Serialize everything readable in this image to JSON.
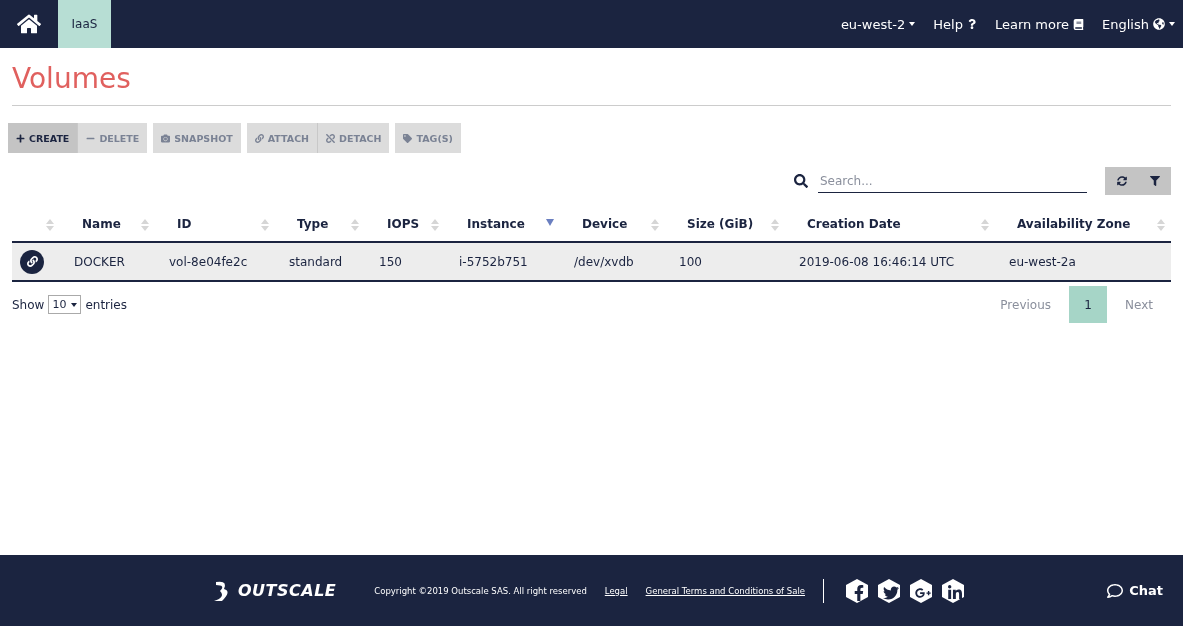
{
  "nav": {
    "section": "IaaS",
    "section_selected": true,
    "right": [
      {
        "label": "eu-west-2",
        "kind": "dropdown"
      },
      {
        "label": "Help",
        "kind": "help"
      },
      {
        "label": "Learn more",
        "kind": "book"
      },
      {
        "label": "English",
        "kind": "language"
      }
    ]
  },
  "title": "Volumes",
  "toolbar": [
    [
      {
        "label": "CREATE",
        "kind": "plus",
        "disabled": false
      },
      {
        "label": "DELETE",
        "kind": "minus",
        "disabled": true
      }
    ],
    [
      {
        "label": "SNAPSHOT",
        "kind": "camera",
        "disabled": true
      }
    ],
    [
      {
        "label": "ATTACH",
        "kind": "link",
        "disabled": true
      },
      {
        "label": "DETACH",
        "kind": "unlink",
        "disabled": true
      }
    ],
    [
      {
        "label": "TAG(S)",
        "kind": "tag",
        "disabled": true
      }
    ]
  ],
  "search": {
    "placeholder": "Search..."
  },
  "table": {
    "columns": [
      {
        "label": "Name",
        "sorted": false
      },
      {
        "label": "ID",
        "sorted": false
      },
      {
        "label": "Type",
        "sorted": false
      },
      {
        "label": "IOPS",
        "sorted": false
      },
      {
        "label": "Instance",
        "sorted": true
      },
      {
        "label": "Device",
        "sorted": false
      },
      {
        "label": "Size (GiB)",
        "sorted": false
      },
      {
        "label": "Creation Date",
        "sorted": false
      },
      {
        "label": "Availability Zone",
        "sorted": false
      }
    ],
    "rows": [
      {
        "attached": true,
        "cells": [
          "DOCKER",
          "vol-8e04fe2c",
          "standard",
          "150",
          "i-5752b751",
          "/dev/xvdb",
          "100",
          "2019-06-08 16:46:14 UTC",
          "eu-west-2a"
        ]
      }
    ]
  },
  "length": {
    "show": "Show",
    "value": "10",
    "entries": "entries"
  },
  "pagination": {
    "previous": "Previous",
    "pages": [
      {
        "label": "1",
        "selected": true
      }
    ],
    "next": "Next"
  },
  "footer": {
    "logo": "OUTSCALE",
    "copyright": "Copyright ©2019 Outscale SAS. All right reserved",
    "links": [
      "Legal",
      "General Terms and Conditions of Sale"
    ],
    "social": [
      {
        "kind": "facebook"
      },
      {
        "kind": "twitter"
      },
      {
        "kind": "googleplus"
      },
      {
        "kind": "linkedin"
      }
    ],
    "chat": "Chat"
  }
}
